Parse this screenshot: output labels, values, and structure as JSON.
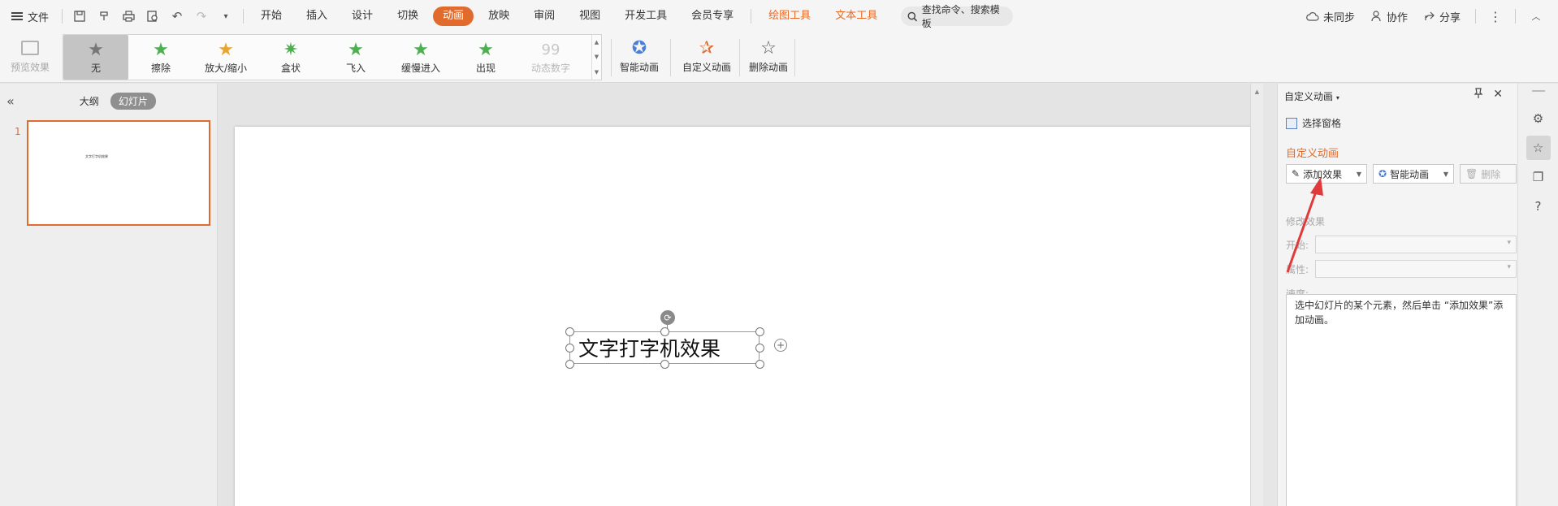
{
  "menubar": {
    "file_label": "文件",
    "tabs": [
      {
        "label": "开始",
        "style": "normal"
      },
      {
        "label": "插入",
        "style": "normal"
      },
      {
        "label": "设计",
        "style": "normal"
      },
      {
        "label": "切换",
        "style": "normal"
      },
      {
        "label": "动画",
        "style": "active"
      },
      {
        "label": "放映",
        "style": "normal"
      },
      {
        "label": "审阅",
        "style": "normal"
      },
      {
        "label": "视图",
        "style": "normal"
      },
      {
        "label": "开发工具",
        "style": "normal"
      },
      {
        "label": "会员专享",
        "style": "normal"
      },
      {
        "label": "绘图工具",
        "style": "orange"
      },
      {
        "label": "文本工具",
        "style": "orange"
      }
    ],
    "search_placeholder": "查找命令、搜索模板",
    "unsynced_label": "未同步",
    "collab_label": "协作",
    "share_label": "分享"
  },
  "ribbon": {
    "preview_label": "预览效果",
    "gallery": [
      {
        "label": "无",
        "icon": "star-gray-icon",
        "selected": true,
        "disabled": false
      },
      {
        "label": "擦除",
        "icon": "star-wipe-icon",
        "selected": false,
        "disabled": false
      },
      {
        "label": "放大/缩小",
        "icon": "star-zoom-icon",
        "selected": false,
        "disabled": false
      },
      {
        "label": "盒状",
        "icon": "star-box-icon",
        "selected": false,
        "disabled": false
      },
      {
        "label": "飞入",
        "icon": "star-fly-icon",
        "selected": false,
        "disabled": false
      },
      {
        "label": "缓慢进入",
        "icon": "star-slow-icon",
        "selected": false,
        "disabled": false
      },
      {
        "label": "出现",
        "icon": "star-appear-icon",
        "selected": false,
        "disabled": false
      },
      {
        "label": "动态数字",
        "icon": "number-99-icon",
        "selected": false,
        "disabled": true
      }
    ],
    "smart_anim_label": "智能动画",
    "custom_anim_label": "自定义动画",
    "delete_anim_label": "删除动画"
  },
  "left_panel": {
    "outline_label": "大纲",
    "slides_label": "幻灯片",
    "slide_number": "1",
    "thumb_text": "文字打字机效果"
  },
  "slide": {
    "text": "文字打字机效果"
  },
  "pane": {
    "title": "自定义动画",
    "select_pane_label": "选择窗格",
    "section_title": "自定义动画",
    "add_effect_label": "添加效果",
    "smart_anim_label": "智能动画",
    "delete_label": "删除",
    "modify_title": "修改效果",
    "start_label": "开始:",
    "property_label": "属性:",
    "speed_label": "速度:",
    "hint": "选中幻灯片的某个元素，然后单击 “添加效果”添加动画。"
  },
  "colors": {
    "accent": "#e06b2c",
    "star_green": "#4caf50"
  }
}
